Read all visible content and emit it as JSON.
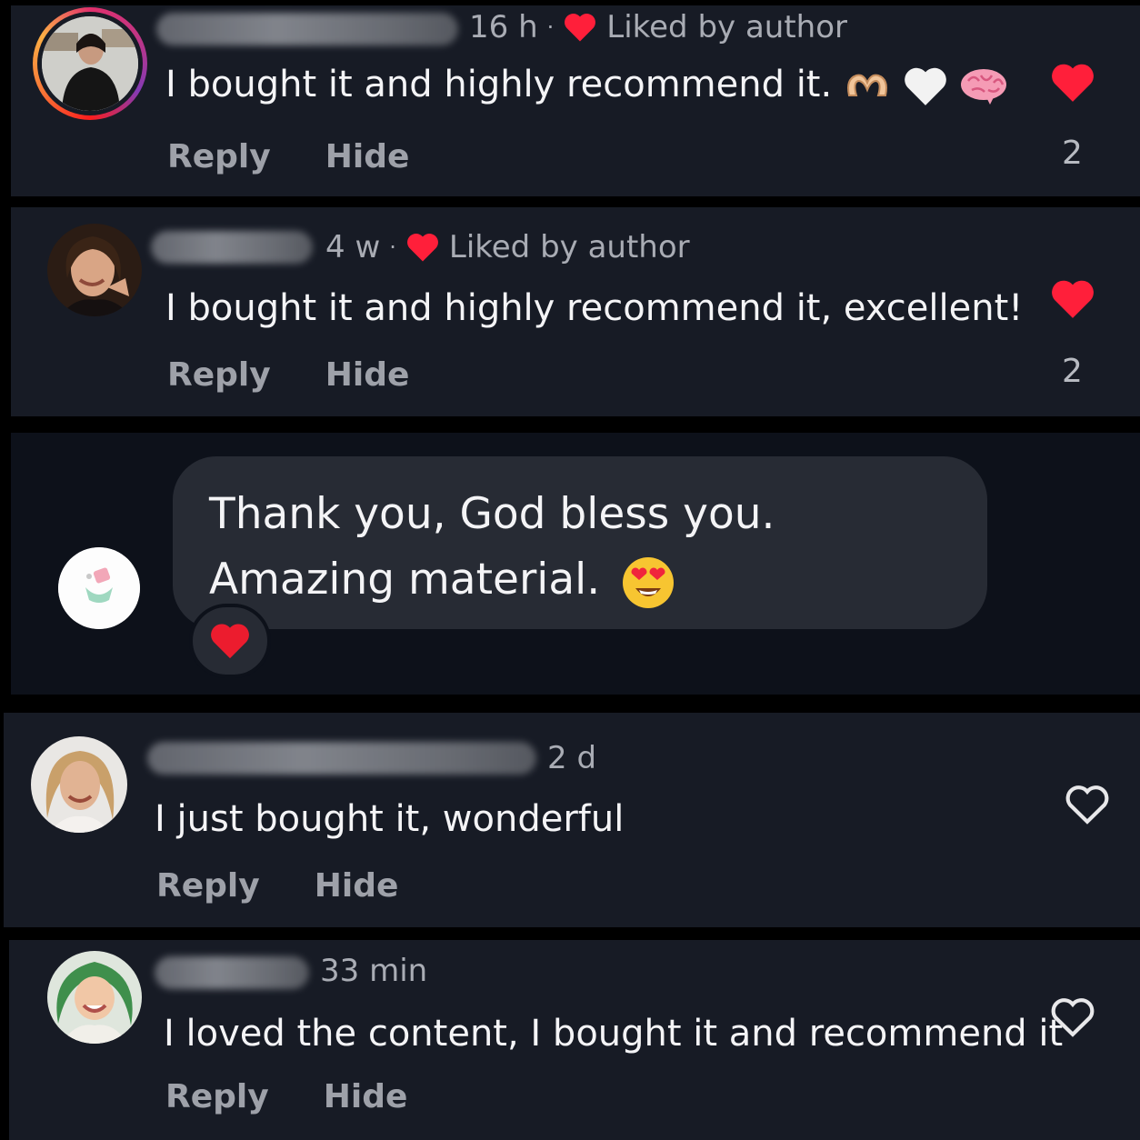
{
  "comments": [
    {
      "time": "16 h",
      "liked_by": "Liked by author",
      "text": "I bought it and highly recommend it.",
      "emojis": [
        "heart-hands-icon",
        "white-heart-icon",
        "brain-icon"
      ],
      "reply": "Reply",
      "hide": "Hide",
      "likes": "2",
      "liked": true
    },
    {
      "time": "4 w",
      "liked_by": "Liked by author",
      "text": "I bought it and highly recommend it, excellent!",
      "reply": "Reply",
      "hide": "Hide",
      "likes": "2",
      "liked": true
    },
    {
      "time": "2 d",
      "text": "I just bought it, wonderful",
      "reply": "Reply",
      "hide": "Hide",
      "liked": false
    },
    {
      "time": "33 min",
      "text": "I loved the content, I bought it and recommend it",
      "reply": "Reply",
      "hide": "Hide",
      "liked": false
    }
  ],
  "author_reply": {
    "text": "Thank you, God bless you. Amazing material.",
    "emoji": "heart-eyes-icon",
    "reaction": "red-heart-icon"
  },
  "colors": {
    "like_red": "#ff1f3a",
    "card_bg": "#171b25",
    "bubble_bg": "#272b34",
    "muted_text": "#a9acb4"
  },
  "separators": {
    "dot": "·"
  }
}
